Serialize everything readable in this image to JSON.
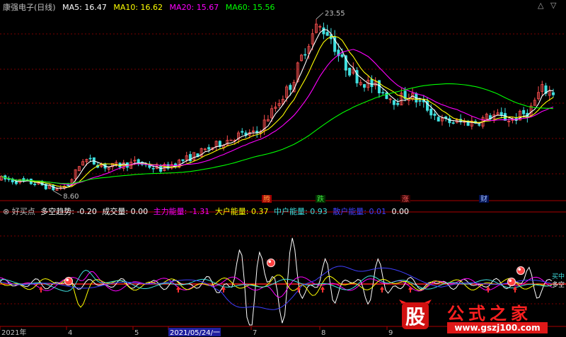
{
  "colors": {
    "bg": "#000000",
    "grid": "#7a0000",
    "axis": "#aa0000",
    "up": "#ff5050",
    "down": "#40e0e0",
    "ma5": "#ffffff",
    "ma10": "#ffff00",
    "ma20": "#ff00ff",
    "ma60": "#00ff00",
    "text": "#c0c0c0"
  },
  "main_panel": {
    "title": "康强电子(日线)",
    "ma": [
      {
        "label": "MA5:",
        "value": "16.47"
      },
      {
        "label": "MA10:",
        "value": "16.62"
      },
      {
        "label": "MA20:",
        "value": "15.67"
      },
      {
        "label": "MA60:",
        "value": "15.56"
      }
    ],
    "price_high_label": "23.55",
    "price_low_label": "8.60",
    "markers": [
      "腾",
      "跌",
      "涨",
      "财"
    ]
  },
  "sub_panel": {
    "title": "好买点",
    "items": [
      {
        "label": "多空趋势:",
        "value": "-0.20"
      },
      {
        "label": "成交量:",
        "value": "0.00"
      },
      {
        "label": "主力能量:",
        "value": "-1.31"
      },
      {
        "label": "大户能量:",
        "value": "0.37"
      },
      {
        "label": "中户能量:",
        "value": "0.93"
      },
      {
        "label": "散户能量:",
        "value": "0.01"
      },
      {
        "label": "",
        "value": "0.00"
      }
    ],
    "right_labels": [
      "买中",
      "多空"
    ]
  },
  "x_axis": {
    "labels": [
      "2021年",
      "4",
      "5",
      "2021/05/24/一",
      "7",
      "8",
      "9"
    ]
  },
  "watermark": {
    "logo_char": "股",
    "brand": "公式之家",
    "url": "www.gszj100.com"
  },
  "chart_data": {
    "type": "candlestick",
    "price_range": [
      8.6,
      23.55
    ],
    "series": [
      {
        "name": "MA5",
        "color": "#ffffff"
      },
      {
        "name": "MA10",
        "color": "#ffff00"
      },
      {
        "name": "MA20",
        "color": "#ff00ff"
      },
      {
        "name": "MA60",
        "color": "#00ff00"
      }
    ],
    "indicator_series": [
      {
        "name": "多空趋势",
        "color": "#ffffff"
      },
      {
        "name": "主力能量",
        "color": "#ff00ff"
      },
      {
        "name": "大户能量",
        "color": "#ffff00"
      },
      {
        "name": "中户能量",
        "color": "#40e0e0"
      },
      {
        "name": "散户能量",
        "color": "#4040ff"
      }
    ]
  }
}
